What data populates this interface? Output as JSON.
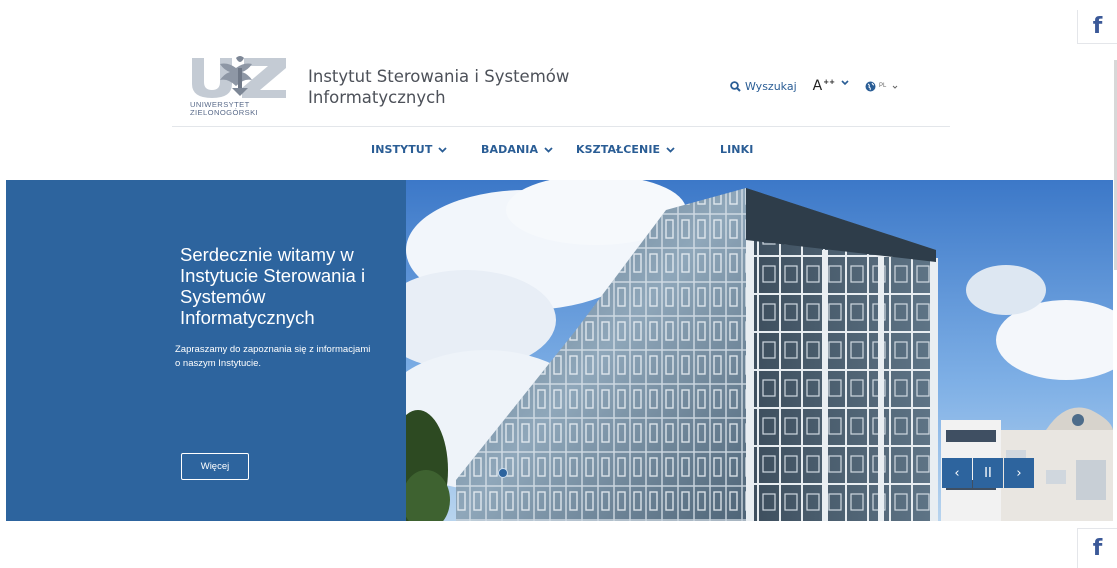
{
  "header": {
    "logo_line1": "UNIWERSYTET",
    "logo_line2": "ZIELONOGÓRSKI",
    "site_title": "Instytut Sterowania i Systemów Informatycznych"
  },
  "tools": {
    "search_label": "Wyszukaj",
    "font_size_label": "A",
    "font_size_sup": "++",
    "language": "PL"
  },
  "nav": {
    "items": [
      {
        "label": "INSTYTUT",
        "has_dropdown": true
      },
      {
        "label": "BADANIA",
        "has_dropdown": true
      },
      {
        "label": "KSZTAŁCENIE",
        "has_dropdown": true
      },
      {
        "label": "LINKI",
        "has_dropdown": false
      }
    ]
  },
  "hero": {
    "title": "Serdecznie witamy w Instytucie Sterowania i Systemów Informatycznych",
    "text": "Zapraszamy do zapoznania się z informacjami o naszym Instytucie.",
    "button_label": "Więcej"
  },
  "slider": {
    "prev": "‹",
    "pause": "II",
    "next": "›"
  },
  "social": {
    "facebook": "f"
  },
  "colors": {
    "primary": "#2d649e",
    "facebook": "#3b5998",
    "title_text": "#4d5159"
  },
  "icons": [
    "search-icon",
    "chevron-down-icon",
    "globe-icon",
    "facebook-icon",
    "university-logo"
  ]
}
